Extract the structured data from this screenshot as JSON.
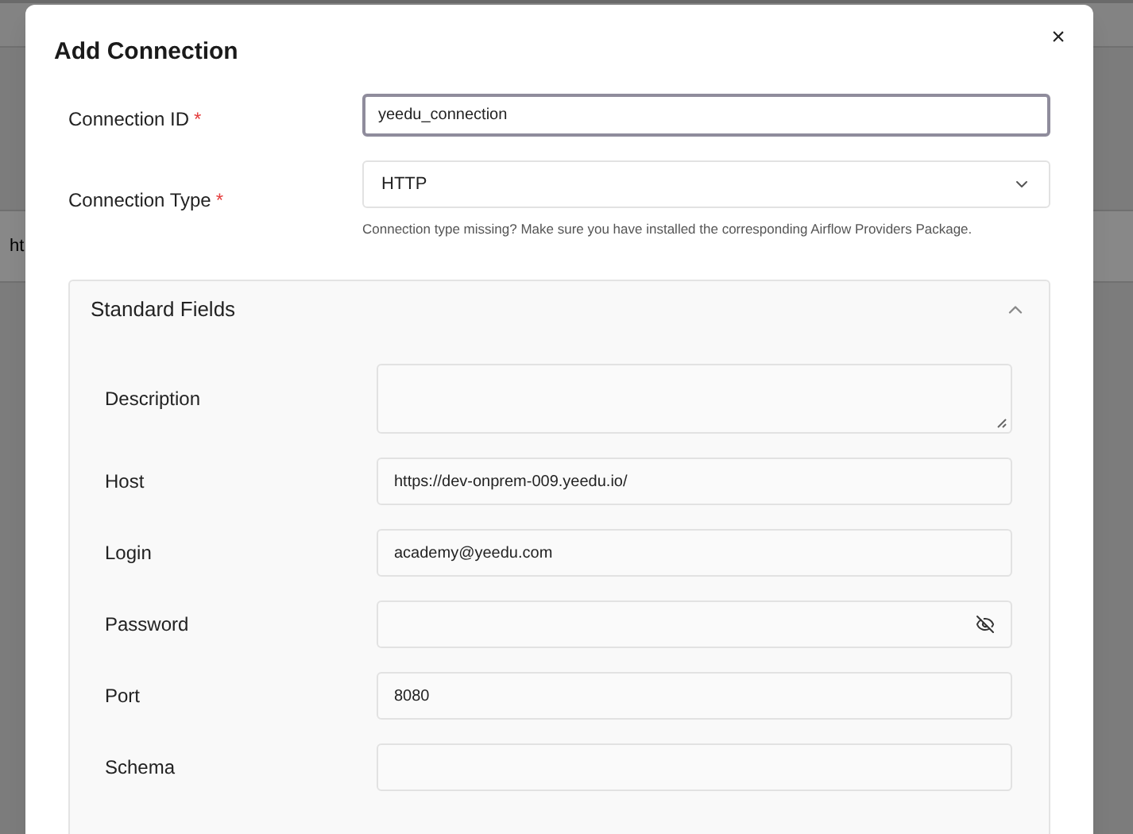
{
  "background": {
    "row_text": "ht"
  },
  "dialog": {
    "title": "Add Connection",
    "close": "×",
    "fields": [
      {
        "label": "Connection ID",
        "required_mark": "*",
        "kind": "text",
        "value": "yeedu_connection",
        "focused": true
      },
      {
        "label": "Connection Type",
        "required_mark": "*",
        "kind": "select",
        "value": "HTTP",
        "focused": false,
        "help": "Connection type missing? Make sure you have installed the corresponding Airflow Providers Package."
      }
    ],
    "section": {
      "title": "Standard Fields",
      "expanded": true,
      "fields": [
        {
          "label": "Description",
          "kind": "textarea"
        },
        {
          "label": "Host",
          "kind": "text",
          "value": "https://dev-onprem-009.yeedu.io/"
        },
        {
          "label": "Login",
          "kind": "text",
          "value": "academy@yeedu.com"
        },
        {
          "label": "Password",
          "kind": "password"
        },
        {
          "label": "Port",
          "kind": "text",
          "value": "8080"
        },
        {
          "label": "Schema",
          "kind": "text"
        }
      ]
    }
  }
}
